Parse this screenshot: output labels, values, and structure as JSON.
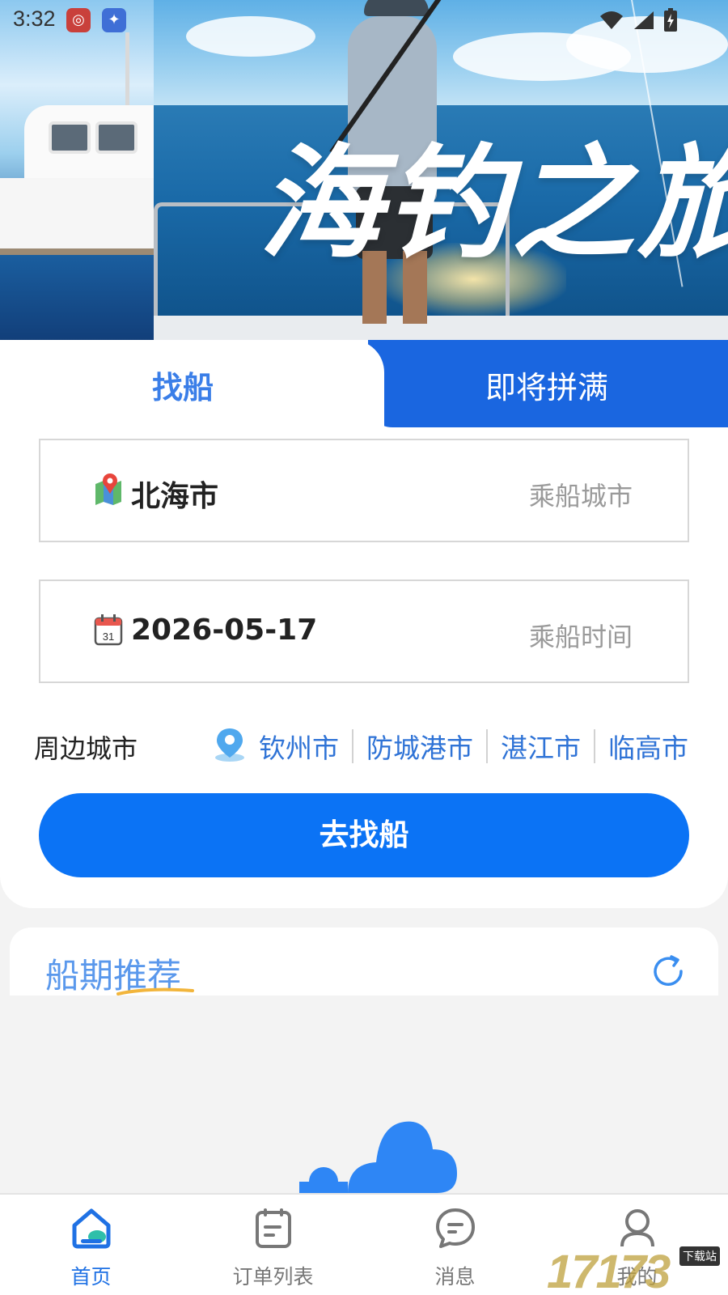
{
  "status_bar": {
    "time": "3:32"
  },
  "banner": {
    "title": "海钓之旅"
  },
  "tabs": [
    {
      "label": "找船",
      "active": true
    },
    {
      "label": "即将拼满",
      "active": false
    }
  ],
  "search": {
    "city": {
      "value": "北海市",
      "hint": "乘船城市"
    },
    "date": {
      "value": "2026-05-17",
      "hint": "乘船时间",
      "calendar_day": "31"
    }
  },
  "nearby": {
    "label": "周边城市",
    "cities": [
      "钦州市",
      "防城港市",
      "湛江市",
      "临高市"
    ]
  },
  "go_button": {
    "label": "去找船"
  },
  "recommend": {
    "title": "船期推荐"
  },
  "bottom_nav": [
    {
      "label": "首页",
      "icon": "home-icon",
      "active": true
    },
    {
      "label": "订单列表",
      "icon": "order-list-icon",
      "active": false
    },
    {
      "label": "消息",
      "icon": "message-icon",
      "active": false
    },
    {
      "label": "我的",
      "icon": "profile-icon",
      "active": false
    }
  ],
  "watermark": {
    "text": "17173",
    "tag": "下载站"
  },
  "colors": {
    "accent": "#0b73f5",
    "tab_blue": "#1a66e0",
    "link": "#2f73d6"
  }
}
